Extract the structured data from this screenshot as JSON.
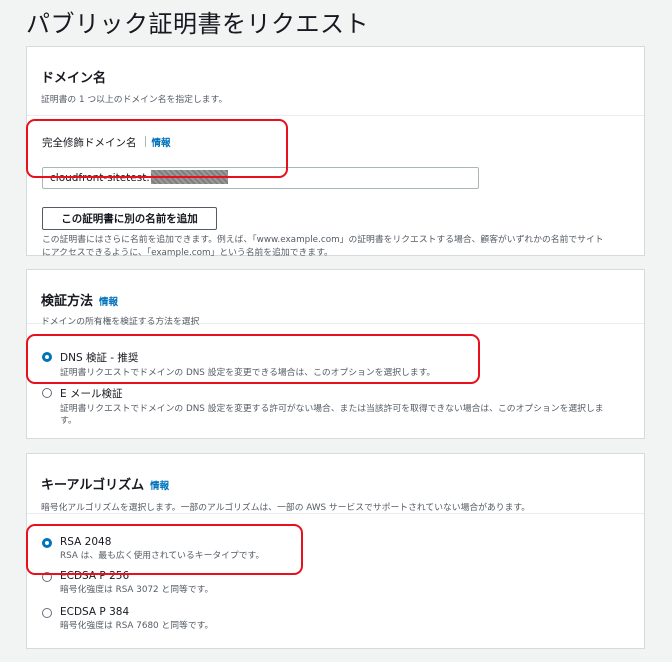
{
  "page": {
    "title": "パブリック証明書をリクエスト"
  },
  "domain_section": {
    "title": "ドメイン名",
    "description": "証明書の 1 つ以上のドメイン名を指定します。",
    "field_label": "完全修飾ドメイン名",
    "info": "情報",
    "input_value": "cloudfront-sitetest.",
    "add_button": "この証明書に別の名前を追加",
    "help_line1": "この証明書にはさらに名前を追加できます。例えば、「www.example.com」の証明書をリクエストする場合、顧客がいずれかの名前でサイト",
    "help_line2": "にアクセスできるように、「example.com」という名前を追加できます。"
  },
  "validation_section": {
    "title": "検証方法",
    "info": "情報",
    "description": "ドメインの所有権を検証する方法を選択",
    "options": [
      {
        "label": "DNS 検証 - 推奨",
        "description": "証明書リクエストでドメインの DNS 設定を変更できる場合は、このオプションを選択します。",
        "selected": true
      },
      {
        "label": "E メール検証",
        "description": "証明書リクエストでドメインの DNS 設定を変更する許可がない場合、または当該許可を取得できない場合は、このオプションを選択しま",
        "description2": "す。",
        "selected": false
      }
    ]
  },
  "key_section": {
    "title": "キーアルゴリズム",
    "info": "情報",
    "description": "暗号化アルゴリズムを選択します。一部のアルゴリズムは、一部の AWS サービスでサポートされていない場合があります。",
    "options": [
      {
        "label": "RSA 2048",
        "description": "RSA は、最も広く使用されているキータイプです。",
        "selected": true
      },
      {
        "label": "ECDSA P 256",
        "description": "暗号化強度は RSA 3072 と同等です。",
        "selected": false
      },
      {
        "label": "ECDSA P 384",
        "description": "暗号化強度は RSA 7680 と同等です。",
        "selected": false
      }
    ]
  },
  "colors": {
    "accent": "#0073bb",
    "highlight": "#e8101a",
    "border": "#d5dbdb",
    "background": "#f2f3f3"
  }
}
